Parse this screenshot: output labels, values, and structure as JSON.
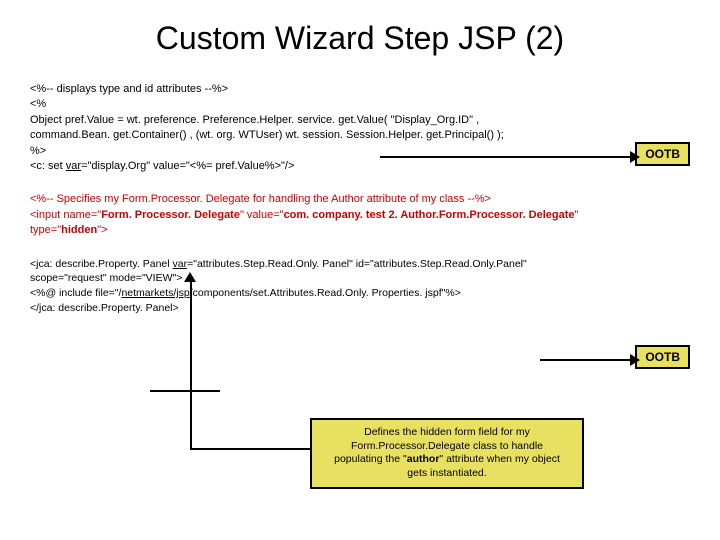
{
  "title": "Custom Wizard Step JSP (2)",
  "block1": {
    "l1": "<%-- displays type and id attributes --%>",
    "l2": "<%",
    "l3": "  Object pref.Value = wt. preference. Preference.Helper. service. get.Value( \"Display_Org.ID\" ,",
    "l4": "command.Bean. get.Container() , (wt. org. WTUser) wt. session. Session.Helper. get.Principal() );",
    "l5": "%>",
    "l6a": "<c: set ",
    "l6var": "var",
    "l6b": "=\"display.Org\" value=\"<%= pref.Value%>\"/>"
  },
  "block2": {
    "l1": "<%-- Specifies my Form.Processor. Delegate for handling the Author attribute of my class --%>",
    "l2a": "<input name=\"",
    "l2b": "Form. Processor. Delegate",
    "l2c": "\" value=\"",
    "l2d": "com. company. test 2. Author.Form.Processor. Delegate",
    "l2e": "\"",
    "l3a": "type=\"",
    "l3b": "hidden",
    "l3c": "\">"
  },
  "block3": {
    "l1a": "<jca: describe.Property. Panel ",
    "l1var": "var",
    "l1b": "=\"attributes.Step.Read.Only. Panel\" id=\"attributes.Step.Read.Only.Panel\"",
    "l2": "scope=\"request\" mode=\"VIEW\">",
    "l3a": "<%@ include file=\"/",
    "l3u": "netmarkets/jsp",
    "l3b": "/components/set.Attributes.Read.Only. Properties. jspf\"%>",
    "l4": "</jca: describe.Property. Panel>"
  },
  "badge": "OOTB",
  "callout": {
    "l1": "Defines the hidden form field for my",
    "l2": "Form.Processor.Delegate class to handle",
    "l3a": "populating the \"",
    "l3b": "author",
    "l3c": "\" attribute when my object",
    "l4": "gets instantiated."
  }
}
